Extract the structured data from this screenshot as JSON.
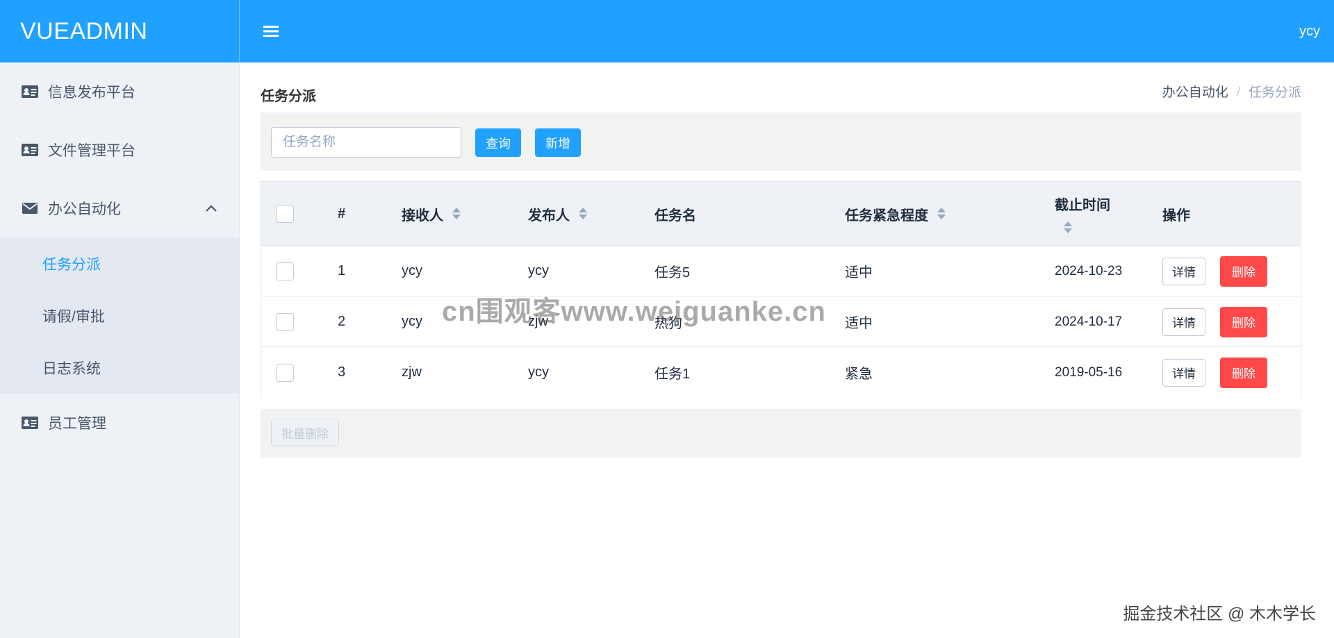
{
  "header": {
    "logo": "VUEADMIN",
    "user": "ycy"
  },
  "sidebar": {
    "items": [
      {
        "label": "信息发布平台"
      },
      {
        "label": "文件管理平台"
      },
      {
        "label": "办公自动化",
        "expanded": true,
        "children": [
          {
            "label": "任务分派",
            "active": true
          },
          {
            "label": "请假/审批"
          },
          {
            "label": "日志系统"
          }
        ]
      },
      {
        "label": "员工管理"
      }
    ]
  },
  "page": {
    "title": "任务分派",
    "breadcrumb": [
      "办公自动化",
      "任务分派"
    ],
    "breadcrumb_separator": "/"
  },
  "toolbar": {
    "search_placeholder": "任务名称",
    "search_value": "",
    "query_label": "查询",
    "add_label": "新增"
  },
  "table": {
    "headers": {
      "index": "#",
      "receiver": "接收人",
      "publisher": "发布人",
      "task_name": "任务名",
      "urgency": "任务紧急程度",
      "deadline": "截止时间",
      "actions": "操作"
    },
    "rows": [
      {
        "index": "1",
        "receiver": "ycy",
        "publisher": "ycy",
        "task_name": "任务5",
        "urgency": "适中",
        "deadline": "2024-10-23"
      },
      {
        "index": "2",
        "receiver": "ycy",
        "publisher": "zjw",
        "task_name": "热狗",
        "urgency": "适中",
        "deadline": "2024-10-17"
      },
      {
        "index": "3",
        "receiver": "zjw",
        "publisher": "ycy",
        "task_name": "任务1",
        "urgency": "紧急",
        "deadline": "2019-05-16"
      }
    ],
    "detail_label": "详情",
    "delete_label": "删除"
  },
  "footer": {
    "batch_delete_label": "批量删除"
  },
  "overlay": {
    "watermark": "cn围观客www.weiguanke.cn",
    "signature": "掘金技术社区 @ 木木学长"
  },
  "colors": {
    "primary": "#20a0ff",
    "danger": "#ff4949",
    "sidebar_bg": "#eef1f6",
    "submenu_bg": "#e4e8f1",
    "toolbar_bg": "#f2f2f2"
  }
}
